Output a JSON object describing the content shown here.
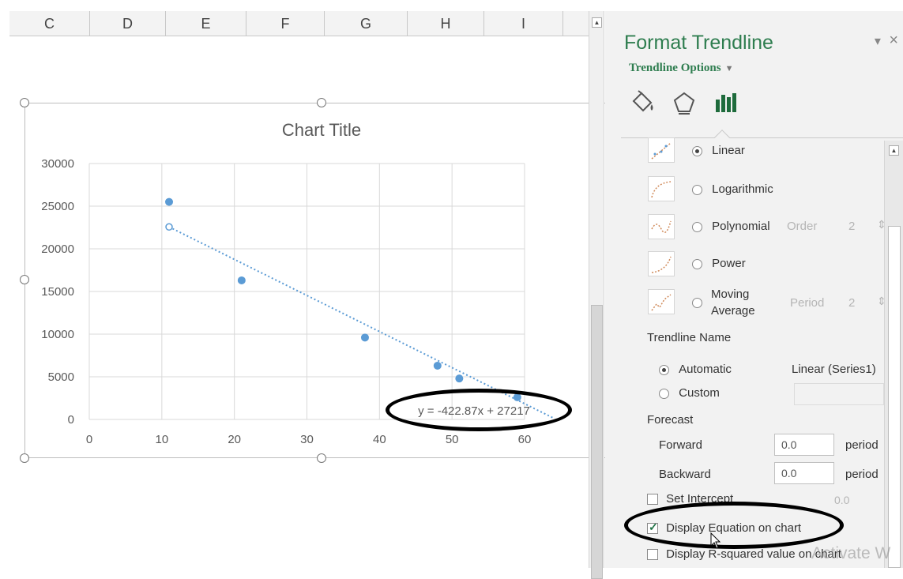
{
  "sheet": {
    "columns": [
      "C",
      "D",
      "E",
      "F",
      "G",
      "H",
      "I"
    ]
  },
  "chart_data": {
    "type": "scatter",
    "title": "Chart Title",
    "xlabel": "",
    "ylabel": "",
    "xlim": [
      0,
      60
    ],
    "ylim": [
      0,
      30000
    ],
    "x_ticks": [
      "0",
      "10",
      "20",
      "30",
      "40",
      "50",
      "60"
    ],
    "y_ticks": [
      "0",
      "5000",
      "10000",
      "15000",
      "20000",
      "25000",
      "30000"
    ],
    "grid": true,
    "series": [
      {
        "points": [
          [
            11,
            25500
          ],
          [
            21,
            16300
          ],
          [
            38,
            9600
          ],
          [
            48,
            6300
          ],
          [
            51,
            4800
          ],
          [
            59,
            2600
          ]
        ]
      }
    ],
    "trendline": {
      "type": "linear",
      "equation": "y = -422.87x + 27217",
      "start": [
        11,
        22566
      ],
      "end": [
        64,
        154
      ]
    },
    "colors": {
      "points": "#5b9bd5",
      "trendline": "#5b9bd5",
      "grid": "#d9d9d9"
    }
  },
  "pane": {
    "title": "Format Trendline",
    "options_dropdown": "Trendline Options",
    "controls": {
      "dropdown": "▾",
      "close": "×"
    },
    "types": {
      "linear": "Linear",
      "logarithmic": "Logarithmic",
      "polynomial": "Polynomial",
      "order_label": "Order",
      "order_value": "2",
      "power": "Power",
      "moving_average_1": "Moving",
      "moving_average_2": "Average",
      "period_label": "Period",
      "period_value": "2"
    },
    "trendline_name": {
      "heading": "Trendline Name",
      "automatic": "Automatic",
      "automatic_value": "Linear (Series1)",
      "custom": "Custom"
    },
    "forecast": {
      "heading": "Forecast",
      "forward": "Forward",
      "forward_value": "0.0",
      "backward": "Backward",
      "backward_value": "0.0",
      "unit": "period"
    },
    "set_intercept": {
      "label": "Set Intercept",
      "value": "0.0"
    },
    "display_equation": "Display Equation on chart",
    "display_r_squared": "Display R-squared value on chart"
  },
  "watermark": "Activate W"
}
